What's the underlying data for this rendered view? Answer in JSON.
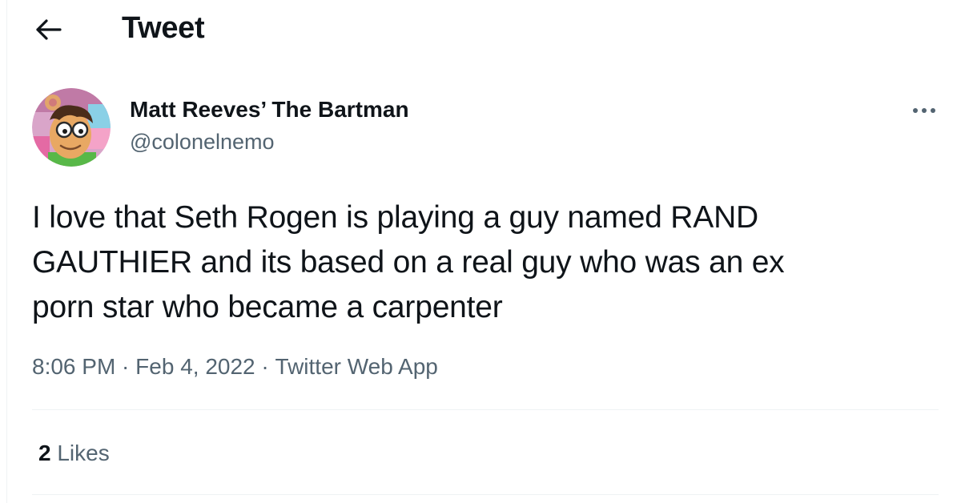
{
  "header": {
    "title": "Tweet",
    "back_icon": "arrow-left-icon"
  },
  "author": {
    "display_name": "Matt Reeves’ The Bartman",
    "handle": "@colonelnemo",
    "avatar": "cartoon-aardvark-avatar"
  },
  "more_icon": "ellipsis-icon",
  "tweet": {
    "text": "I love that Seth Rogen is playing a guy named RAND\nGAUTHIER and its based on a real guy who was an ex\nporn star who became a carpenter",
    "time": "8:06 PM",
    "separator": " · ",
    "date": "Feb 4, 2022",
    "source": "Twitter Web App"
  },
  "stats": {
    "likes_count": "2",
    "likes_label": "Likes"
  },
  "colors": {
    "text_primary": "#0f1419",
    "text_secondary": "#536471",
    "divider": "#eff3f4"
  }
}
